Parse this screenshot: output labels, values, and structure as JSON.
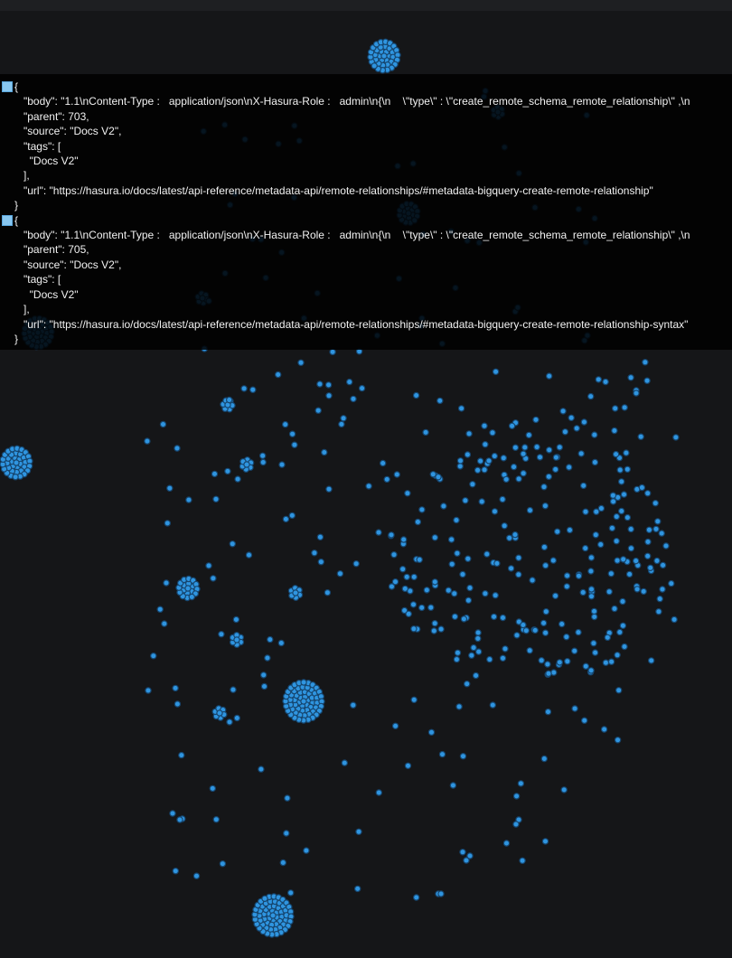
{
  "tooltip": {
    "records": [
      {
        "open_brace": "{",
        "body_line": "   \"body\": \"1.1\\nContent-Type :   application/json\\nX-Hasura-Role :   admin\\n{\\n    \\\"type\\\" : \\\"create_remote_schema_remote_relationship\\\" ,\\n",
        "parent_line": "   \"parent\": 703,",
        "source_line": "   \"source\": \"Docs V2\",",
        "tags_open": "   \"tags\": [",
        "tag_line": "     \"Docs V2\"",
        "tags_close": "   ],",
        "url_line": "   \"url\": \"https://hasura.io/docs/latest/api-reference/metadata-api/remote-relationships/#metadata-bigquery-create-remote-relationship\"",
        "close_brace": "}"
      },
      {
        "open_brace": "{",
        "body_line": "   \"body\": \"1.1\\nContent-Type :   application/json\\nX-Hasura-Role :   admin\\n{\\n    \\\"type\\\" : \\\"create_remote_schema_remote_relationship\\\" ,\\n",
        "parent_line": "   \"parent\": 705,",
        "source_line": "   \"source\": \"Docs V2\",",
        "tags_open": "   \"tags\": [",
        "tag_line": "     \"Docs V2\"",
        "tags_close": "   ],",
        "url_line": "   \"url\": \"https://hasura.io/docs/latest/api-reference/metadata-api/remote-relationships/#metadata-bigquery-create-remote-relationship-syntax\"",
        "close_brace": "}"
      }
    ]
  },
  "colors": {
    "background": "#151618",
    "topbar": "#1e1f22",
    "node_fill": "#2f95e0",
    "node_stroke": "#16466f",
    "tooltip_bg": "rgba(0,0,0,0.86)",
    "text": "#f2f2f2",
    "checkbox": "#88c7f0"
  },
  "icons": {
    "record_checkbox": "checkbox-icon"
  }
}
